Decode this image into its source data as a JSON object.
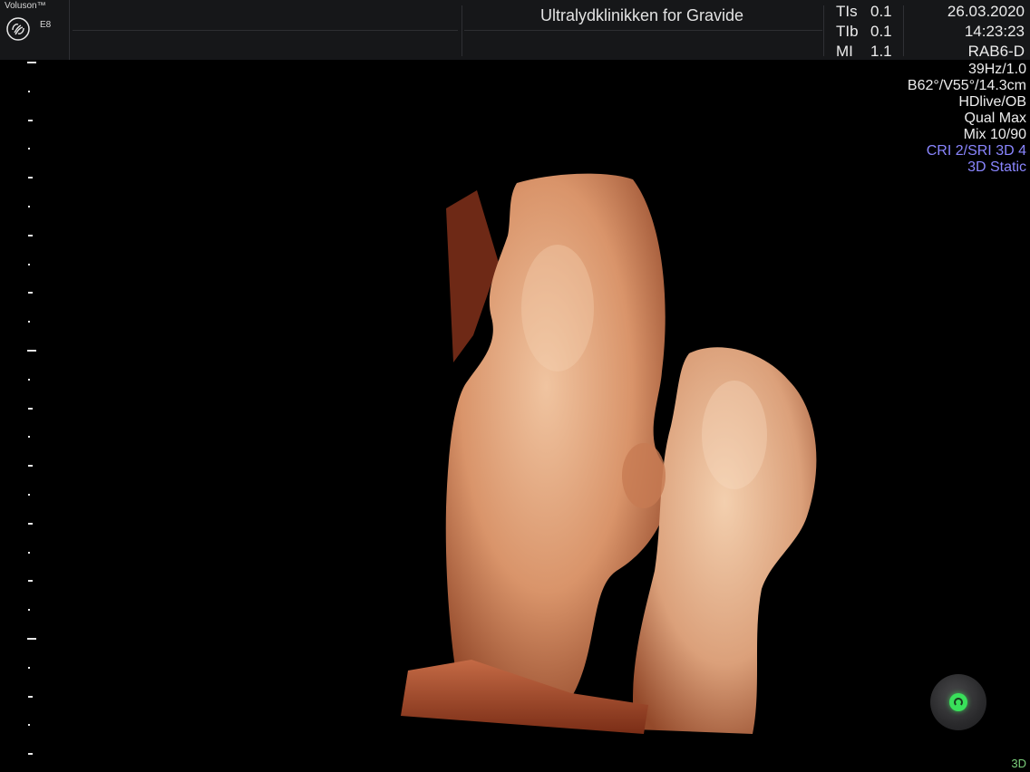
{
  "header": {
    "brand": "Voluson™",
    "model": "E8",
    "clinic": "Ultralydklinikken for Gravide",
    "indices": [
      {
        "label": "TIs",
        "value": "0.1"
      },
      {
        "label": "TIb",
        "value": "0.1"
      },
      {
        "label": "MI",
        "value": "1.1"
      }
    ],
    "date": "26.03.2020",
    "time": "14:23:23",
    "probe": "RAB6-D"
  },
  "params": {
    "frame_rate": "39Hz/1.0",
    "volume": "B62°/V55°/14.3cm",
    "preset": "HDlive/OB",
    "quality": "Qual Max",
    "mix": "Mix 10/90",
    "cri": "CRI 2/SRI 3D 4",
    "mode": "3D Static"
  },
  "colors": {
    "accent_blue": "#8a86ff",
    "knob_green": "#39e05a",
    "render_skin": "#e0a078"
  },
  "icons": {
    "logo": "ge-logo-icon",
    "knob": "trackball-icon"
  },
  "footer": {
    "mode_label": "3D"
  }
}
